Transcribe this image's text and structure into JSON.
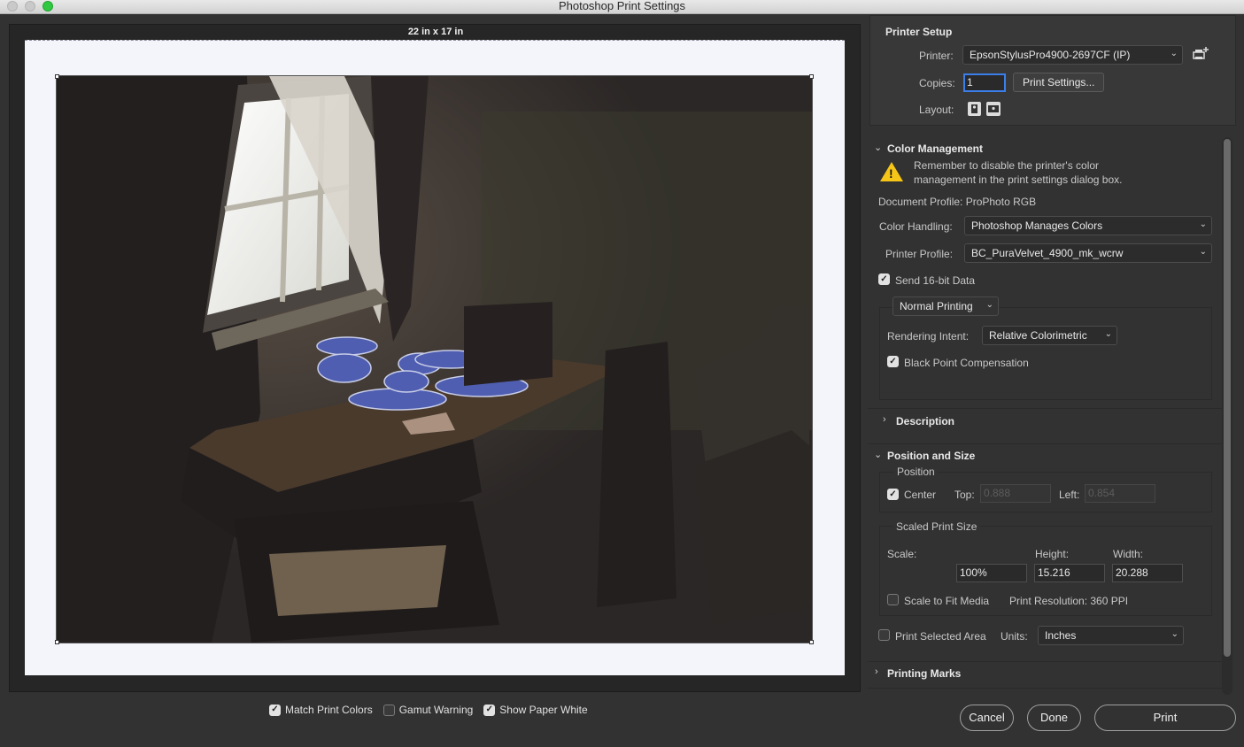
{
  "window": {
    "title": "Photoshop Print Settings"
  },
  "preview": {
    "paper_size": "22 in x 17 in",
    "options": [
      {
        "label": "Match Print Colors",
        "checked": true
      },
      {
        "label": "Gamut Warning",
        "checked": false
      },
      {
        "label": "Show Paper White",
        "checked": true
      }
    ]
  },
  "printer_setup": {
    "title": "Printer Setup",
    "printer_label": "Printer:",
    "printer_value": "EpsonStylusPro4900-2697CF (IP)",
    "copies_label": "Copies:",
    "copies_value": "1",
    "print_settings_label": "Print Settings...",
    "layout_label": "Layout:"
  },
  "color_management": {
    "title": "Color Management",
    "warning_line1": "Remember to disable the printer's color",
    "warning_line2": "management in the print settings dialog box.",
    "document_profile": "Document Profile: ProPhoto RGB",
    "color_handling_label": "Color Handling:",
    "color_handling_value": "Photoshop Manages Colors",
    "printer_profile_label": "Printer Profile:",
    "printer_profile_value": "BC_PuraVelvet_4900_mk_wcrw",
    "send16_label": "Send 16-bit Data",
    "send16_checked": true,
    "normal_printing": "Normal Printing",
    "rendering_intent_label": "Rendering Intent:",
    "rendering_intent_value": "Relative Colorimetric",
    "bpc_label": "Black Point Compensation",
    "bpc_checked": true
  },
  "description": {
    "title": "Description"
  },
  "position_size": {
    "title": "Position and Size",
    "position_label": "Position",
    "center_label": "Center",
    "center_checked": true,
    "top_label": "Top:",
    "top_value": "0.888",
    "left_label": "Left:",
    "left_value": "0.854",
    "scaled_label": "Scaled Print Size",
    "scale_label": "Scale:",
    "height_label": "Height:",
    "width_label": "Width:",
    "scale_value": "100%",
    "height_value": "15.216",
    "width_value": "20.288",
    "fit_label": "Scale to Fit Media",
    "fit_checked": false,
    "resolution": "Print Resolution: 360 PPI",
    "selected_area_label": "Print Selected Area",
    "selected_area_checked": false,
    "units_label": "Units:",
    "units_value": "Inches"
  },
  "printing_marks": {
    "title": "Printing Marks"
  },
  "footer": {
    "cancel": "Cancel",
    "done": "Done",
    "print": "Print"
  }
}
